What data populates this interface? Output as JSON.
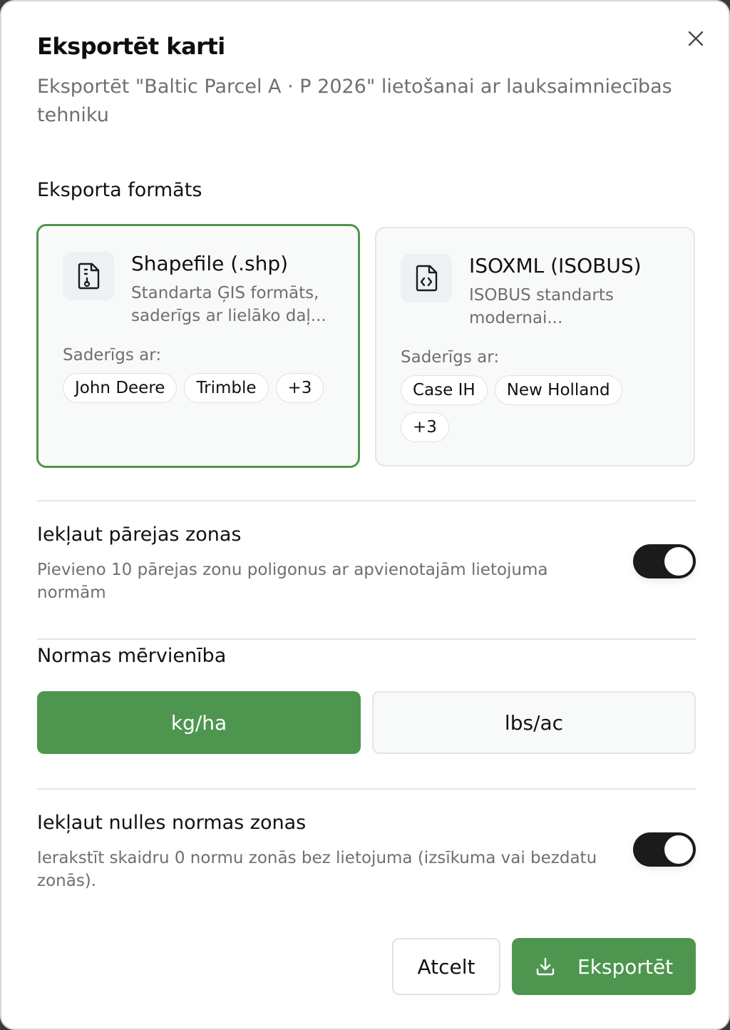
{
  "dialog": {
    "title": "Eksportēt karti",
    "subtitle": "Eksportēt \"Baltic Parcel A · P 2026\" lietošanai ar lauksaimniecības tehniku",
    "close_icon": "close-icon"
  },
  "format_section": {
    "heading": "Eksporta formāts",
    "cards": [
      {
        "title": "Shapefile (.shp)",
        "description": "Standarta ĢIS formāts, saderīgs ar lielāko daļ...",
        "compat_label": "Saderīgs ar:",
        "chips": [
          "John Deere",
          "Trimble",
          "+3"
        ],
        "icon": "file-map-icon",
        "selected": true
      },
      {
        "title": "ISOXML (ISOBUS)",
        "description": "ISOBUS standarts modernai...",
        "compat_label": "Saderīgs ar:",
        "chips": [
          "Case IH",
          "New Holland",
          "+3"
        ],
        "icon": "file-code-icon",
        "selected": false
      }
    ]
  },
  "transition_zones": {
    "title": "Iekļaut pārejas zonas",
    "description": "Pievieno 10 pārejas zonu poligonus ar apvienotajām lietojuma normām",
    "enabled": true
  },
  "rate_unit": {
    "heading": "Normas mērvienība",
    "options": [
      "kg/ha",
      "lbs/ac"
    ],
    "selected": "kg/ha"
  },
  "zero_rate_zones": {
    "title": "Iekļaut nulles normas zonas",
    "description": "Ierakstīt skaidru 0 normu zonās bez lietojuma (izsīkuma vai bezdatu zonās).",
    "enabled": true
  },
  "actions": {
    "cancel_label": "Atcelt",
    "export_label": "Eksportēt",
    "export_icon": "download-icon"
  },
  "colors": {
    "accent": "#4e9650",
    "toggle_on": "#1b1b1b",
    "muted_text": "#6f6f6f"
  }
}
